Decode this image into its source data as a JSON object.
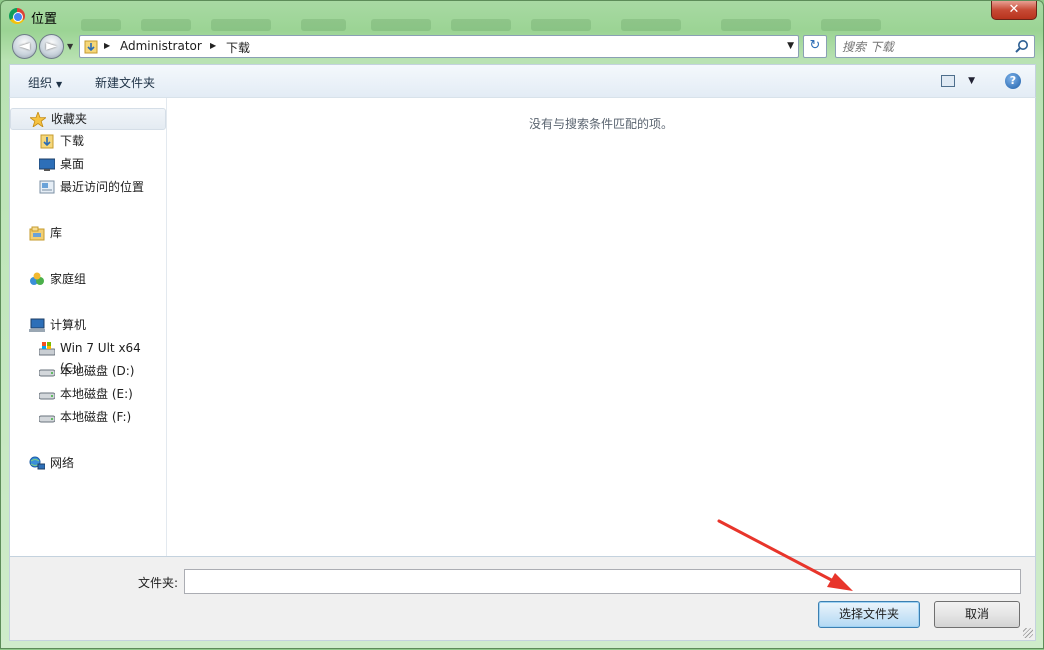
{
  "window": {
    "title": "位置",
    "close_glyph": "✕"
  },
  "nav": {
    "back_glyph": "◄",
    "forward_glyph": "►",
    "breadcrumb": [
      "Administrator",
      "下载"
    ],
    "refresh_glyph": "↻",
    "search_placeholder": "搜索 下载"
  },
  "toolbar": {
    "organize_label": "组织",
    "new_folder_label": "新建文件夹",
    "help_glyph": "?"
  },
  "sidebar": {
    "favorites": {
      "label": "收藏夹",
      "items": [
        "下载",
        "桌面",
        "最近访问的位置"
      ]
    },
    "library": {
      "label": "库"
    },
    "homegroup": {
      "label": "家庭组"
    },
    "computer": {
      "label": "计算机",
      "items": [
        "Win 7 Ult x64 (C:)",
        "本地磁盘 (D:)",
        "本地磁盘 (E:)",
        "本地磁盘 (F:)"
      ]
    },
    "network": {
      "label": "网络"
    }
  },
  "content": {
    "empty_message": "没有与搜索条件匹配的项。"
  },
  "footer": {
    "folder_label": "文件夹:",
    "folder_value": "",
    "select_button": "选择文件夹",
    "cancel_button": "取消"
  },
  "colors": {
    "annotation_arrow": "#e8352b",
    "chrome_green": "#9bd494"
  }
}
